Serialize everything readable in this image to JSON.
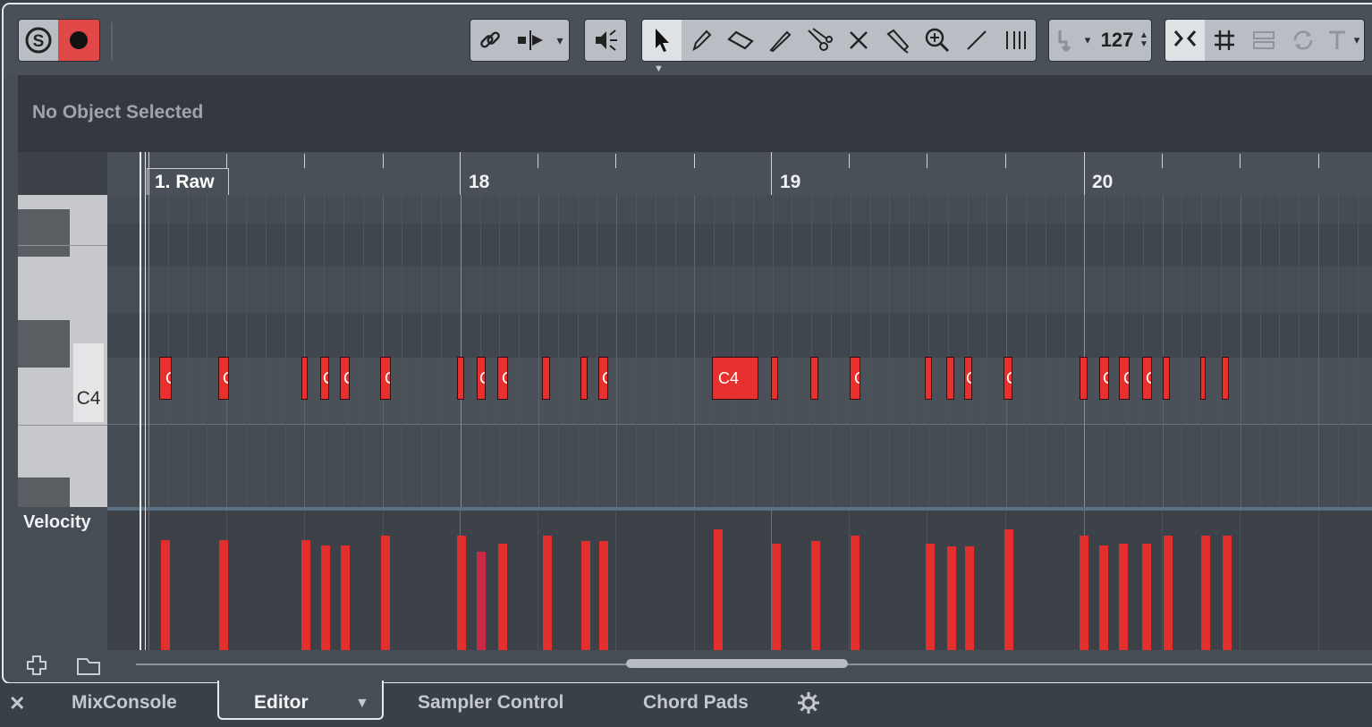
{
  "transport": {
    "solo_label": "S",
    "record_label": "●"
  },
  "toolbar": {
    "velocity_value": "127"
  },
  "info_bar": {
    "status": "No Object Selected"
  },
  "ruler": {
    "part_label": "1. Raw",
    "bars": [
      "18",
      "19",
      "20"
    ]
  },
  "keyboard": {
    "highlight_key": "C4"
  },
  "notes": {
    "selected_label": "C4",
    "small_label": "C"
  },
  "velocity_lane": {
    "label": "Velocity"
  },
  "tabs": {
    "close": "✕",
    "mixconsole": "MixConsole",
    "editor": "Editor",
    "sampler_control": "Sampler Control",
    "chord_pads": "Chord Pads"
  },
  "colors": {
    "note": "#e8302e",
    "record": "#e04848",
    "background": "#3a4048"
  }
}
